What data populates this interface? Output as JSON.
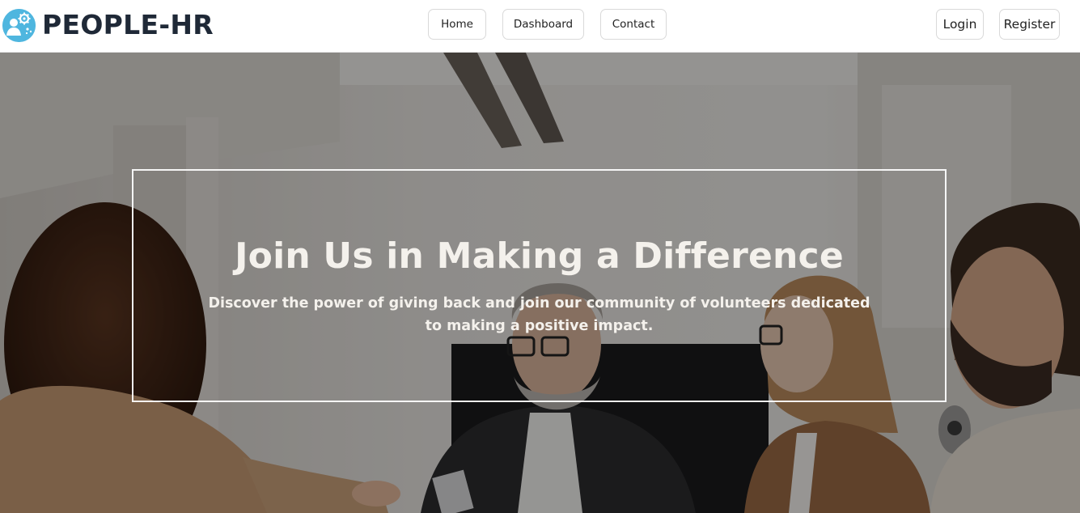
{
  "brand": {
    "name": "PEOPLE-HR",
    "logo_icon": "people-gear-icon",
    "accent_color": "#4fb6df"
  },
  "nav": {
    "items": [
      {
        "label": "Home"
      },
      {
        "label": "Dashboard"
      },
      {
        "label": "Contact"
      }
    ]
  },
  "auth": {
    "login_label": "Login",
    "register_label": "Register"
  },
  "hero": {
    "title": "Join Us in Making a Difference",
    "subtitle": "Discover the power of giving back and join our community of volunteers dedicated to making a positive impact.",
    "background": "office-meeting-handshake-photo"
  }
}
